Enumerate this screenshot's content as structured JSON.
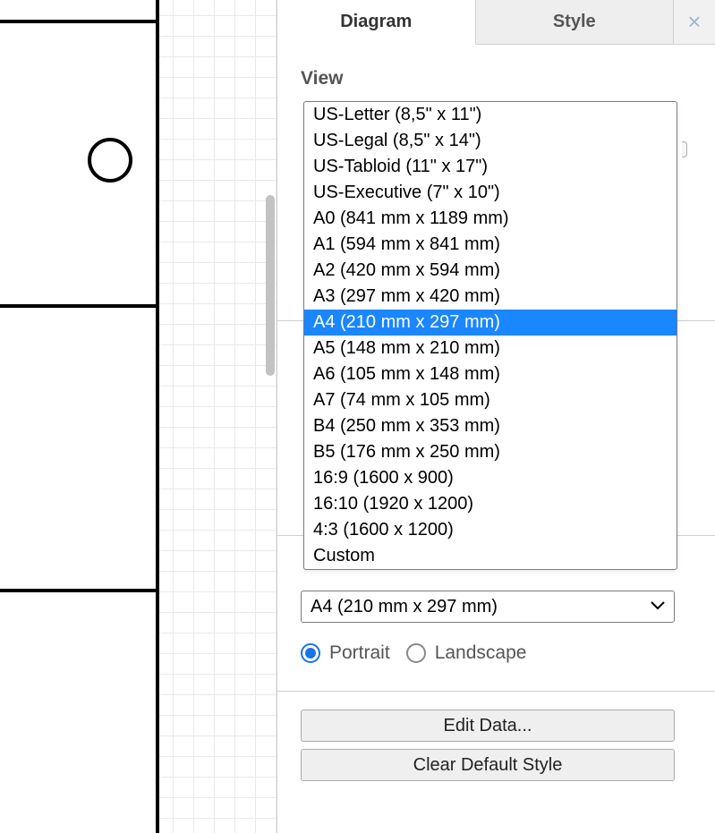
{
  "tabs": {
    "diagram": "Diagram",
    "style": "Style",
    "close_glyph": "×"
  },
  "section": {
    "view": "View"
  },
  "paper_sizes": [
    "US-Letter (8,5\" x 11\")",
    "US-Legal (8,5\" x 14\")",
    "US-Tabloid (11\" x 17\")",
    "US-Executive (7\" x 10\")",
    "A0 (841 mm x 1189 mm)",
    "A1 (594 mm x 841 mm)",
    "A2 (420 mm x 594 mm)",
    "A3 (297 mm x 420 mm)",
    "A4 (210 mm x 297 mm)",
    "A5 (148 mm x 210 mm)",
    "A6 (105 mm x 148 mm)",
    "A7 (74 mm x 105 mm)",
    "B4 (250 mm x 353 mm)",
    "B5 (176 mm x 250 mm)",
    "16:9 (1600 x 900)",
    "16:10 (1920 x 1200)",
    "4:3 (1600 x 1200)",
    "Custom"
  ],
  "paper_size_selected_index": 8,
  "paper_size_selected_label": "A4 (210 mm x 297 mm)",
  "orientation": {
    "portrait": "Portrait",
    "landscape": "Landscape",
    "selected": "portrait"
  },
  "buttons": {
    "edit_data": "Edit Data...",
    "clear_default_style": "Clear Default Style"
  },
  "colors": {
    "highlight": "#1a86ff",
    "accent_radio": "#1a73e8"
  }
}
